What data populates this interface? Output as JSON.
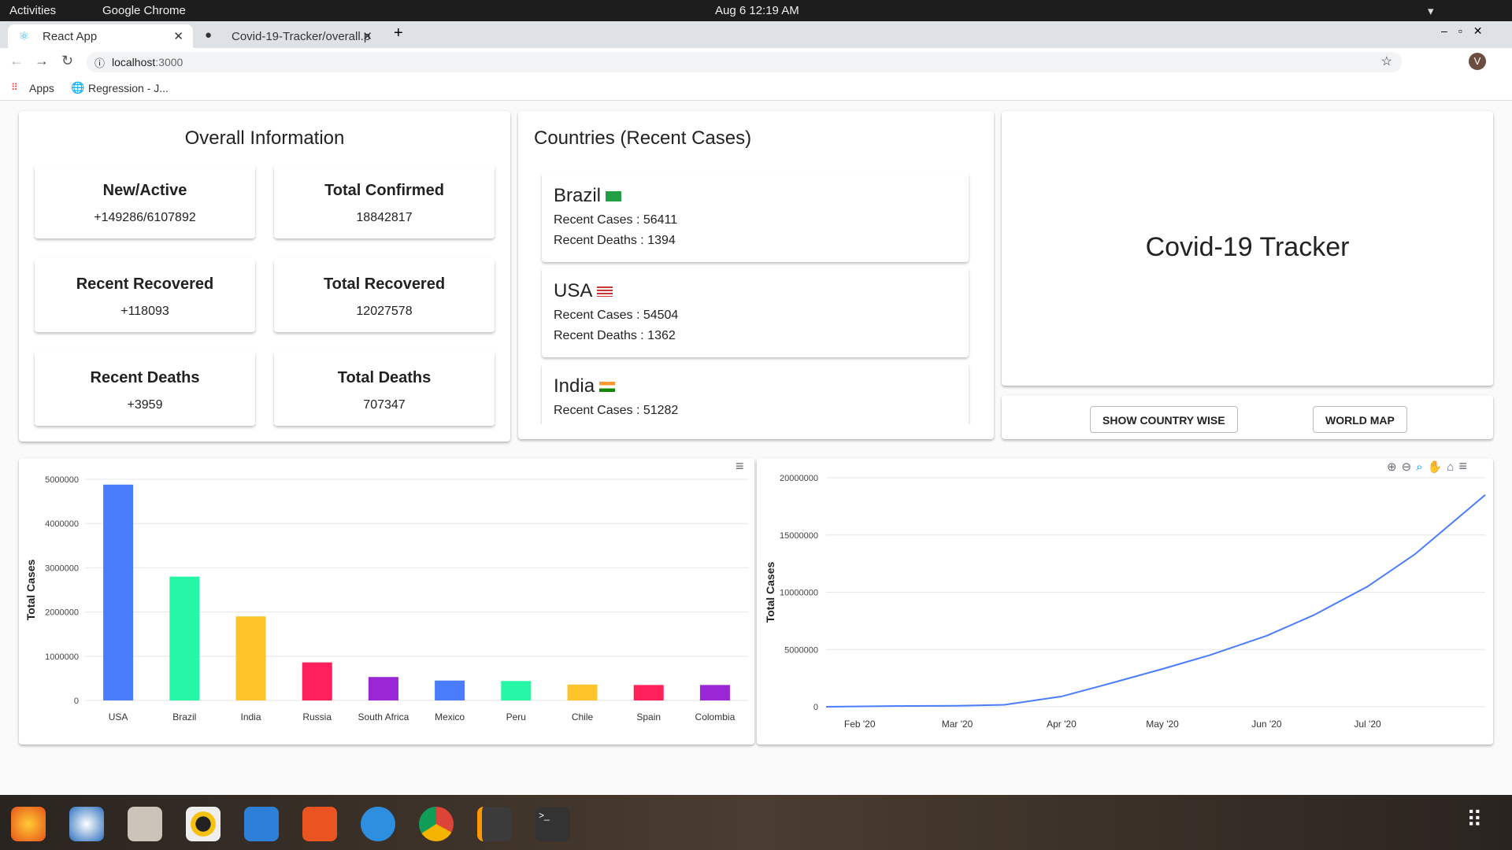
{
  "os": {
    "activities": "Activities",
    "app": "Google Chrome",
    "clock": "Aug 6  12:19 AM"
  },
  "browser": {
    "tabs": [
      {
        "label": "React App"
      },
      {
        "label": "Covid-19-Tracker/overall.p"
      }
    ],
    "url_host": "localhost",
    "url_port": ":3000",
    "bookmarks": [
      {
        "label": "Apps"
      },
      {
        "label": "Regression - J..."
      }
    ],
    "profile_initial": "V"
  },
  "overall": {
    "title": "Overall Information",
    "stats": [
      {
        "label": "New/Active",
        "value": "+149286/6107892"
      },
      {
        "label": "Total Confirmed",
        "value": "18842817"
      },
      {
        "label": "Recent Recovered",
        "value": "+118093"
      },
      {
        "label": "Total Recovered",
        "value": "12027578"
      },
      {
        "label": "Recent Deaths",
        "value": "+3959"
      },
      {
        "label": "Total Deaths",
        "value": "707347"
      }
    ]
  },
  "countries": {
    "title": "Countries (Recent Cases)",
    "items": [
      {
        "name": "Brazil",
        "cases": "Recent Cases : 56411",
        "deaths": "Recent Deaths : 1394"
      },
      {
        "name": "USA",
        "cases": "Recent Cases : 54504",
        "deaths": "Recent Deaths : 1362"
      },
      {
        "name": "India",
        "cases": "Recent Cases : 51282",
        "deaths": ""
      }
    ]
  },
  "tracker": {
    "title": "Covid-19 Tracker",
    "show_country_wise": "SHOW COUNTRY WISE",
    "world_map": "WORLD MAP"
  },
  "chart_data": [
    {
      "type": "bar",
      "ylabel": "Total Cases",
      "ylim": [
        0,
        5000000
      ],
      "yticks": [
        "0",
        "1000000",
        "2000000",
        "3000000",
        "4000000",
        "5000000"
      ],
      "categories": [
        "USA",
        "Brazil",
        "India",
        "Russia",
        "South Africa",
        "Mexico",
        "Peru",
        "Chile",
        "Spain",
        "Colombia"
      ],
      "values": [
        4880000,
        2800000,
        1900000,
        860000,
        530000,
        450000,
        440000,
        360000,
        350000,
        350000
      ],
      "colors": [
        "#4a7dfc",
        "#26f7a6",
        "#fec42a",
        "#ff1f5a",
        "#9b26d6",
        "#4a7dfc",
        "#26f7a6",
        "#fec42a",
        "#ff1f5a",
        "#9b26d6"
      ],
      "grid": true
    },
    {
      "type": "line",
      "ylabel": "Total Cases",
      "ylim": [
        0,
        20000000
      ],
      "yticks": [
        "0",
        "5000000",
        "10000000",
        "15000000",
        "20000000"
      ],
      "xticks": [
        {
          "date": "2020-02-01",
          "label": "Feb '20"
        },
        {
          "date": "2020-03-01",
          "label": "Mar '20"
        },
        {
          "date": "2020-04-01",
          "label": "Apr '20"
        },
        {
          "date": "2020-05-01",
          "label": "May '20"
        },
        {
          "date": "2020-06-01",
          "label": "Jun '20"
        },
        {
          "date": "2020-07-01",
          "label": "Jul '20"
        }
      ],
      "xlim": [
        "2020-01-22",
        "2020-08-05"
      ],
      "color": "#4a7dfc",
      "grid": true,
      "x": [
        "2020-01-22",
        "2020-02-15",
        "2020-03-01",
        "2020-03-15",
        "2020-04-01",
        "2020-04-15",
        "2020-05-01",
        "2020-05-15",
        "2020-06-01",
        "2020-06-15",
        "2020-07-01",
        "2020-07-15",
        "2020-08-05"
      ],
      "y": [
        0,
        70000,
        90000,
        170000,
        900000,
        2000000,
        3300000,
        4500000,
        6200000,
        8000000,
        10500000,
        13300000,
        18500000
      ]
    }
  ]
}
